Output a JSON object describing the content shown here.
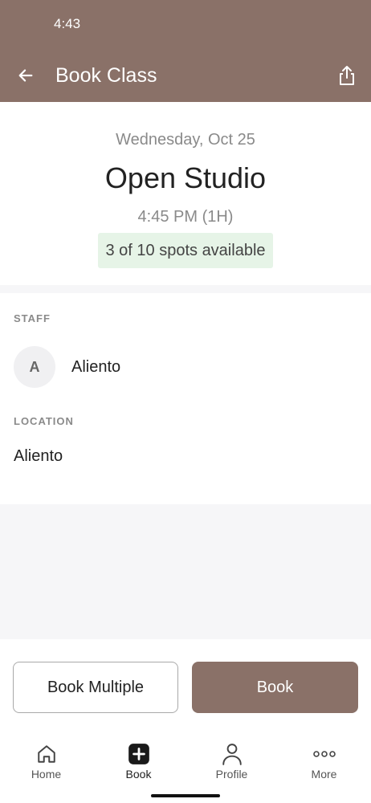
{
  "status_bar": {
    "time": "4:43"
  },
  "header": {
    "title": "Book Class"
  },
  "summary": {
    "date": "Wednesday, Oct 25",
    "class_name": "Open Studio",
    "time": "4:45 PM (1H)",
    "spots": "3 of 10 spots available"
  },
  "staff": {
    "label": "STAFF",
    "initial": "A",
    "name": "Aliento"
  },
  "location": {
    "label": "LOCATION",
    "name": "Aliento"
  },
  "actions": {
    "book_multiple": "Book Multiple",
    "book": "Book"
  },
  "tabs": [
    {
      "label": "Home",
      "icon": "home-icon"
    },
    {
      "label": "Book",
      "icon": "plus-square-icon",
      "active": true
    },
    {
      "label": "Profile",
      "icon": "person-icon"
    },
    {
      "label": "More",
      "icon": "more-dots-icon"
    }
  ],
  "colors": {
    "brand": "#8a7168",
    "spots_bg": "#e6f4e7",
    "band": "#f6f6f8"
  }
}
